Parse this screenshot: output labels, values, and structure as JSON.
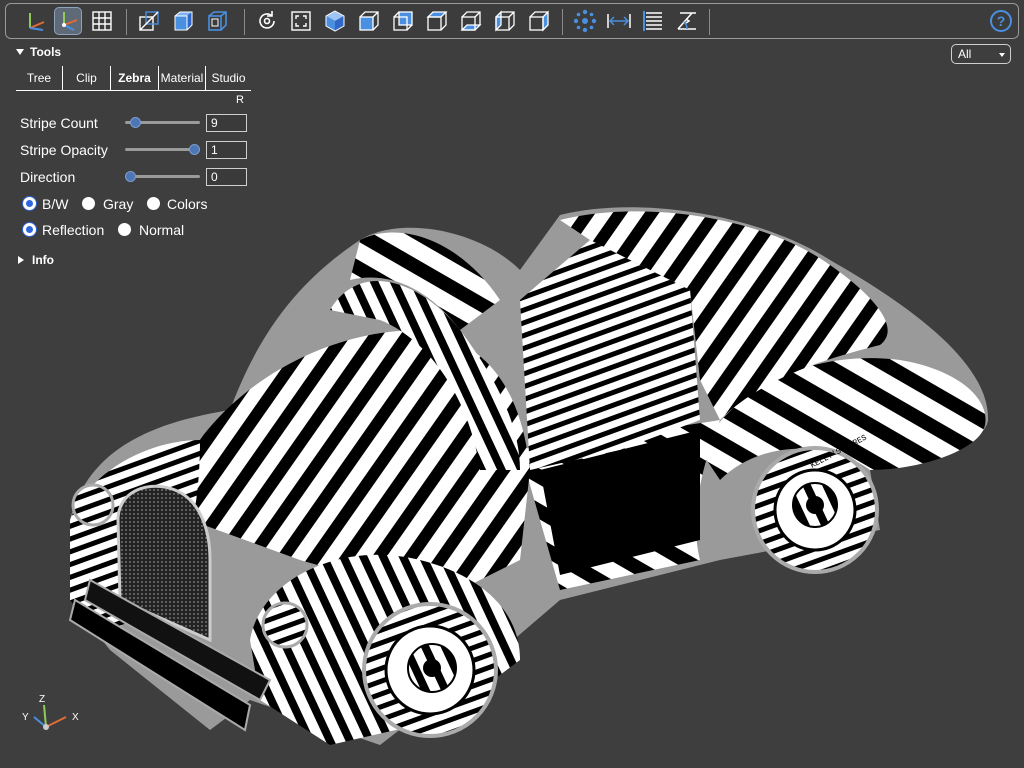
{
  "toolbar": {
    "icons": [
      "axes-icon",
      "axes-orientation-icon",
      "grid-icon",
      "perspective-icon",
      "transparent-icon",
      "black-edges-icon",
      "reset-view-icon",
      "fit-icon",
      "iso-view-icon",
      "front-view-icon",
      "rear-view-icon",
      "top-view-icon",
      "bottom-view-icon",
      "left-view-icon",
      "right-view-icon",
      "explode-icon",
      "distance-measure-icon",
      "properties-icon",
      "angle-measure-icon",
      "help-icon"
    ]
  },
  "tools": {
    "title": "Tools",
    "tabs": [
      "Tree",
      "Clip",
      "Zebra",
      "Material",
      "Studio"
    ],
    "active_tab": "Zebra",
    "r_label": "R"
  },
  "zebra": {
    "stripe_count_label": "Stripe Count",
    "stripe_count_value": "9",
    "stripe_count_fraction": 0.08,
    "stripe_opacity_label": "Stripe Opacity",
    "stripe_opacity_value": "1",
    "stripe_opacity_fraction": 1.0,
    "direction_label": "Direction",
    "direction_value": "0",
    "direction_fraction": 0.0,
    "color_modes": [
      "B/W",
      "Gray",
      "Colors"
    ],
    "color_mode_selected": "B/W",
    "map_modes": [
      "Reflection",
      "Normal"
    ],
    "map_mode_selected": "Reflection"
  },
  "info": {
    "title": "Info"
  },
  "view_select": {
    "value": "All"
  },
  "axes": {
    "z": "Z",
    "y": "Y",
    "x": "X"
  },
  "tire_text": "KELLY'S TIRES",
  "colors": {
    "background": "#3e3e3e",
    "accent": "#2f66e0",
    "icon_blue": "#4a8fe0"
  }
}
